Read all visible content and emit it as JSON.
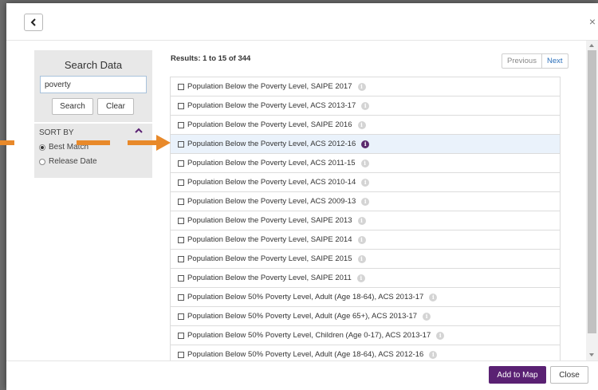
{
  "header": {
    "back_icon": "chevron-left-icon",
    "close_icon": "close-icon",
    "close_glyph": "×"
  },
  "sidebar": {
    "search_title": "Search Data",
    "search_value": "poverty",
    "search_button": "Search",
    "clear_button": "Clear",
    "sort_title": "SORT BY",
    "sort_options": [
      {
        "label": "Best Match",
        "checked": true
      },
      {
        "label": "Release Date",
        "checked": false
      }
    ]
  },
  "results": {
    "summary": "Results: 1 to 15 of 344",
    "previous_label": "Previous",
    "next_label": "Next",
    "items": [
      "Population Below the Poverty Level, SAIPE 2017",
      "Population Below the Poverty Level, ACS 2013-17",
      "Population Below the Poverty Level, SAIPE 2016",
      "Population Below the Poverty Level, ACS 2012-16",
      "Population Below the Poverty Level, ACS 2011-15",
      "Population Below the Poverty Level, ACS 2010-14",
      "Population Below the Poverty Level, ACS 2009-13",
      "Population Below the Poverty Level, SAIPE 2013",
      "Population Below the Poverty Level, SAIPE 2014",
      "Population Below the Poverty Level, SAIPE 2015",
      "Population Below the Poverty Level, SAIPE 2011",
      "Population Below 50% Poverty Level, Adult (Age 18-64), ACS 2013-17",
      "Population Below 50% Poverty Level, Adult (Age 65+), ACS 2013-17",
      "Population Below 50% Poverty Level, Children (Age 0-17), ACS 2013-17",
      "Population Below 50% Poverty Level, Adult (Age 18-64), ACS 2012-16"
    ],
    "highlighted_index": 3,
    "info_glyph": "i"
  },
  "footer": {
    "add_label": "Add to Map",
    "close_label": "Close"
  },
  "colors": {
    "accent": "#5a2173",
    "arrow": "#e8892a",
    "link": "#2a6fba",
    "highlight_row": "#eaf2fb"
  }
}
